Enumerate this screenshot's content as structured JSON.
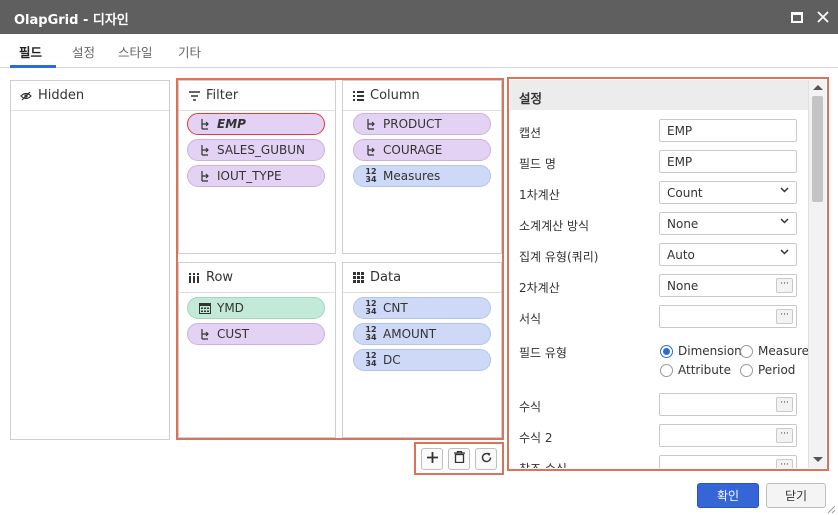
{
  "window": {
    "title": "OlapGrid - 디자인"
  },
  "tabs": [
    {
      "label": "필드"
    },
    {
      "label": "설정"
    },
    {
      "label": "스타일"
    },
    {
      "label": "기타"
    }
  ],
  "hidden_panel": {
    "title": "Hidden"
  },
  "filter_panel": {
    "title": "Filter",
    "items": [
      {
        "label": "EMP",
        "kind": "dimension",
        "selected": true
      },
      {
        "label": "SALES_GUBUN",
        "kind": "dimension"
      },
      {
        "label": "IOUT_TYPE",
        "kind": "dimension"
      }
    ]
  },
  "column_panel": {
    "title": "Column",
    "items": [
      {
        "label": "PRODUCT",
        "kind": "dimension"
      },
      {
        "label": "COURAGE",
        "kind": "dimension"
      },
      {
        "label": "Measures",
        "kind": "measure"
      }
    ]
  },
  "row_panel": {
    "title": "Row",
    "items": [
      {
        "label": "YMD",
        "kind": "period"
      },
      {
        "label": "CUST",
        "kind": "dimension"
      }
    ]
  },
  "data_panel": {
    "title": "Data",
    "items": [
      {
        "label": "CNT",
        "kind": "measure"
      },
      {
        "label": "AMOUNT",
        "kind": "measure"
      },
      {
        "label": "DC",
        "kind": "measure"
      }
    ]
  },
  "icons": {
    "number": [
      "12",
      "34"
    ]
  },
  "settings": {
    "title": "설정",
    "rows": {
      "caption": {
        "label": "캡션",
        "value": "EMP"
      },
      "field_name": {
        "label": "필드 명",
        "value": "EMP"
      },
      "primary_calc": {
        "label": "1차계산",
        "value": "Count"
      },
      "subtotal_method": {
        "label": "소계계산 방식",
        "value": "None"
      },
      "aggregate_type": {
        "label": "집계 유형(쿼리)",
        "value": "Auto"
      },
      "secondary_calc": {
        "label": "2차계산",
        "value": "None"
      },
      "format": {
        "label": "서식",
        "value": ""
      },
      "field_type": {
        "label": "필드 유형",
        "options": [
          "Dimension",
          "Measure",
          "Attribute",
          "Period"
        ],
        "selected": "Dimension"
      },
      "formula": {
        "label": "수식",
        "value": ""
      },
      "formula2": {
        "label": "수식 2",
        "value": ""
      },
      "ref_formula": {
        "label": "참조 수식",
        "value": ""
      }
    },
    "dots_label": "···"
  },
  "footer": {
    "ok_label": "확인",
    "close_label": "닫기"
  },
  "colors": {
    "accent": "#2d6bd4",
    "highlight_border": "#d9735a",
    "dimension_chip": "#e3d2f3",
    "measure_chip": "#cdd9f7",
    "period_chip": "#c3e9d9",
    "titlebar": "#5f5f5f"
  }
}
